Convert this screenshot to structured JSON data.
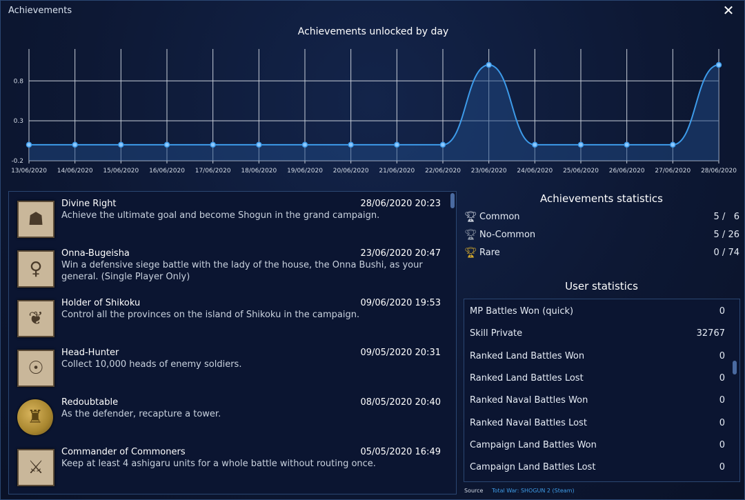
{
  "window": {
    "title": "Achievements",
    "close_label": "✕"
  },
  "chart_data": {
    "type": "area",
    "title": "Achievements unlocked by day",
    "x": [
      "13/06/2020",
      "14/06/2020",
      "15/06/2020",
      "16/06/2020",
      "17/06/2020",
      "18/06/2020",
      "19/06/2020",
      "20/06/2020",
      "21/06/2020",
      "22/06/2020",
      "23/06/2020",
      "24/06/2020",
      "25/06/2020",
      "26/06/2020",
      "27/06/2020",
      "28/06/2020"
    ],
    "values": [
      0,
      0,
      0,
      0,
      0,
      0,
      0,
      0,
      0,
      0,
      1,
      0,
      0,
      0,
      0,
      1
    ],
    "ytick_labels": [
      "0.8",
      "0.3",
      "-0.2"
    ],
    "ytick_values": [
      0.8,
      0.3,
      -0.2
    ],
    "ylim": [
      -0.2,
      1.2
    ],
    "grid": true,
    "line_color": "#3d9bea",
    "fill_color": "#1f4a86"
  },
  "achievements": [
    {
      "name": "Divine Right",
      "date": "28/06/2020 20:23",
      "desc": "Achieve the ultimate goal and become Shogun in the grand campaign.",
      "icon": "shogun-portrait-icon",
      "glyph": "☗"
    },
    {
      "name": "Onna-Bugeisha",
      "date": "23/06/2020 20:47",
      "desc": "Win a defensive siege battle with the lady of the house, the Onna Bushi, as your general. (Single Player Only)",
      "icon": "onna-bushi-icon",
      "glyph": "♀"
    },
    {
      "name": "Holder of Shikoku",
      "date": "09/06/2020 19:53",
      "desc": "Control all the provinces on the island of Shikoku in the campaign.",
      "icon": "shikoku-map-icon",
      "glyph": "❦"
    },
    {
      "name": "Head-Hunter",
      "date": "09/05/2020 20:31",
      "desc": "Collect 10,000 heads of enemy soldiers.",
      "icon": "head-trophy-icon",
      "glyph": "☉"
    },
    {
      "name": "Redoubtable",
      "date": "08/05/2020 20:40",
      "desc": "As the defender, recapture a tower.",
      "icon": "tower-coin-icon",
      "glyph": "♜"
    },
    {
      "name": "Commander of Commoners",
      "date": "05/05/2020 16:49",
      "desc": "Keep at least 4 ashigaru units for a whole battle without routing once.",
      "icon": "ashigaru-icon",
      "glyph": "⚔"
    }
  ],
  "stats": {
    "title": "Achievements statistics",
    "rows": [
      {
        "label": "Common",
        "value": "5 /   6",
        "icon": "trophy-outline-icon",
        "color": "#d8dde6"
      },
      {
        "label": "No-Common",
        "value": "5 / 26",
        "icon": "trophy-silver-icon",
        "color": "#9aa3b0"
      },
      {
        "label": "Rare",
        "value": "0 / 74",
        "icon": "trophy-gold-icon",
        "color": "#e0b12b"
      }
    ]
  },
  "user_stats": {
    "title": "User statistics",
    "rows": [
      {
        "label": "MP Battles Won (quick)",
        "value": "0"
      },
      {
        "label": "Skill Private",
        "value": "32767"
      },
      {
        "label": "Ranked Land Battles Won",
        "value": "0"
      },
      {
        "label": "Ranked Land Battles Lost",
        "value": "0"
      },
      {
        "label": "Ranked Naval Battles Won",
        "value": "0"
      },
      {
        "label": "Ranked Naval Battles Lost",
        "value": "0"
      },
      {
        "label": "Campaign Land Battles Won",
        "value": "0"
      },
      {
        "label": "Campaign Land Battles Lost",
        "value": "0"
      }
    ]
  },
  "source": {
    "label": "Source",
    "link": "Total War: SHOGUN 2 (Steam)"
  }
}
